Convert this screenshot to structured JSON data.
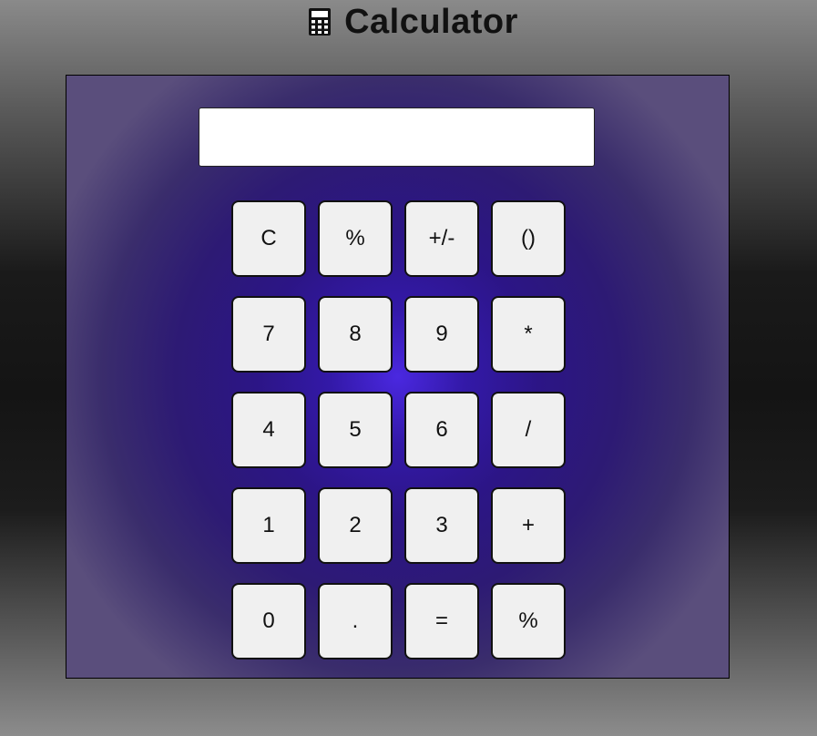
{
  "header": {
    "title": "Calculator",
    "icon": "calculator-icon"
  },
  "display": {
    "value": "",
    "placeholder": ""
  },
  "keypad": {
    "rows": [
      [
        "C",
        "%",
        "+/-",
        "()"
      ],
      [
        "7",
        "8",
        "9",
        "*"
      ],
      [
        "4",
        "5",
        "6",
        "/"
      ],
      [
        "1",
        "2",
        "3",
        "+"
      ],
      [
        "0",
        ".",
        "=",
        "%"
      ]
    ]
  },
  "colors": {
    "panel_center": "#4a28e0",
    "panel_edge": "#5a4e7c",
    "key_background": "#f0f0f0"
  }
}
